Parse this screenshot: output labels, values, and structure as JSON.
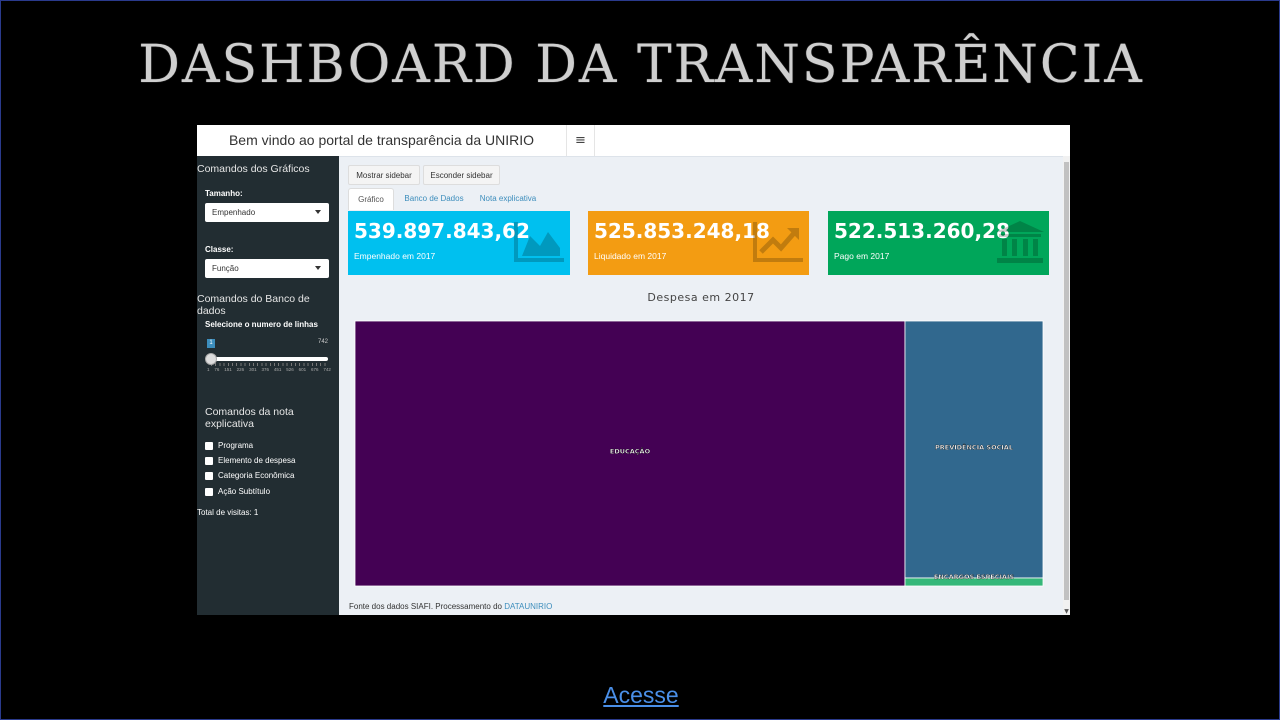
{
  "slide": {
    "title": "Dashboard da Transparência",
    "link_label": "Acesse"
  },
  "header": {
    "brand": "Bem vindo ao portal de transparência da UNIRIO",
    "toggle_icon": "hamburger-icon"
  },
  "sidebar": {
    "graficos_heading": "Comandos dos Gráficos",
    "tamanho_label": "Tamanho:",
    "tamanho_value": "Empenhado",
    "classe_label": "Classe:",
    "classe_value": "Função",
    "banco_heading": "Comandos do Banco de dados",
    "linhas_label": "Selecione o numero de linhas",
    "slider": {
      "min": "1",
      "max": "742",
      "value": "1",
      "ticks": [
        "1",
        "76",
        "151",
        "226",
        "301",
        "376",
        "451",
        "526",
        "601",
        "676",
        "742"
      ]
    },
    "nota_heading": "Comandos da nota explicativa",
    "checkboxes": [
      "Programa",
      "Elemento de despesa",
      "Categoria Econômica",
      "Ação Subtítulo"
    ],
    "visitas": "Total de visitas: 1"
  },
  "buttons": {
    "mostrar": "Mostrar sidebar",
    "esconder": "Esconder sidebar"
  },
  "tabs": [
    "Gráfico",
    "Banco de Dados",
    "Nota explicativa"
  ],
  "value_boxes": [
    {
      "value": "539.897.843,62",
      "label": "Empenhado em 2017",
      "color": "#00c0ef",
      "icon": "area-chart-icon"
    },
    {
      "value": "525.853.248,18",
      "label": "Liquidado em 2017",
      "color": "#f39c12",
      "icon": "line-chart-icon"
    },
    {
      "value": "522.513.260,28",
      "label": "Pago em 2017",
      "color": "#00a65a",
      "icon": "bank-icon"
    }
  ],
  "chart_data": {
    "type": "treemap",
    "title": "Despesa em 2017",
    "items": [
      {
        "label": "EDUCAÇÃO",
        "share": 0.799,
        "color": "#440154"
      },
      {
        "label": "PREVIDÊNCIA SOCIAL",
        "share": 0.195,
        "color": "#31688e"
      },
      {
        "label": "ENCARGOS ESPECIAIS",
        "share": 0.006,
        "color": "#35b779"
      }
    ]
  },
  "footer": {
    "text": "Fonte dos dados SIAFI. Processamento do ",
    "link": "DATAUNIRIO"
  },
  "colors": {
    "sidebar_bg": "#222d32",
    "content_bg": "#ecf0f5",
    "accent": "#3c8dbc"
  }
}
